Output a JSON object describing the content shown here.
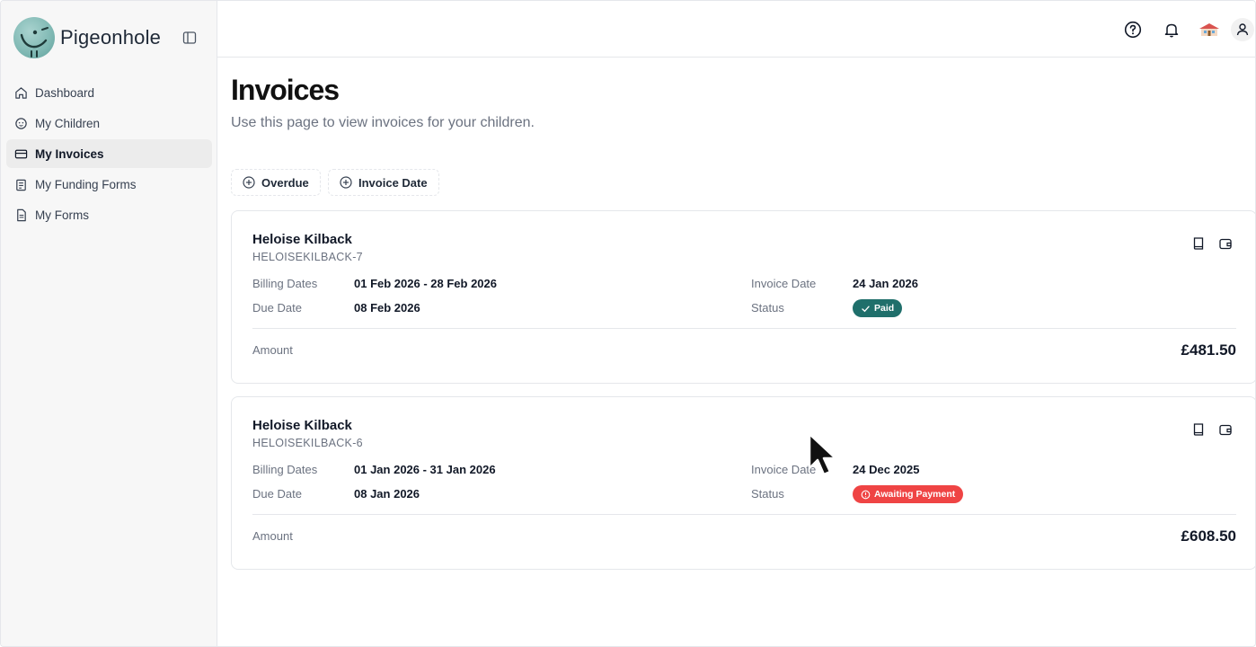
{
  "app": {
    "name": "Pigeonhole"
  },
  "sidebar": {
    "items": [
      {
        "label": "Dashboard",
        "icon": "home-icon"
      },
      {
        "label": "My Children",
        "icon": "child-face-icon"
      },
      {
        "label": "My Invoices",
        "icon": "credit-card-icon",
        "active": true
      },
      {
        "label": "My Funding Forms",
        "icon": "clipboard-icon"
      },
      {
        "label": "My Forms",
        "icon": "document-icon"
      }
    ]
  },
  "page": {
    "title": "Invoices",
    "subtitle": "Use this page to view invoices for your children."
  },
  "filters": [
    {
      "label": "Overdue",
      "icon": "plus-circle-icon"
    },
    {
      "label": "Invoice Date",
      "icon": "plus-circle-icon"
    }
  ],
  "labels": {
    "billing_dates": "Billing Dates",
    "due_date": "Due Date",
    "invoice_date": "Invoice Date",
    "status": "Status",
    "amount": "Amount"
  },
  "invoices": [
    {
      "name": "Heloise Kilback",
      "ref": "HELOISEKILBACK-7",
      "billing_dates": "01 Feb 2026 - 28 Feb 2026",
      "due_date": "08 Feb 2026",
      "invoice_date": "24 Jan 2026",
      "status": "Paid",
      "status_color": "#1f6f6b",
      "amount": "£481.50"
    },
    {
      "name": "Heloise Kilback",
      "ref": "HELOISEKILBACK-6",
      "billing_dates": "01 Jan 2026 - 31 Jan 2026",
      "due_date": "08 Jan 2026",
      "invoice_date": "24 Dec 2025",
      "status": "Awaiting Payment",
      "status_color": "#ef4444",
      "amount": "£608.50"
    }
  ],
  "colors": {
    "accent": "#1f6f6b",
    "danger": "#ef4444"
  }
}
